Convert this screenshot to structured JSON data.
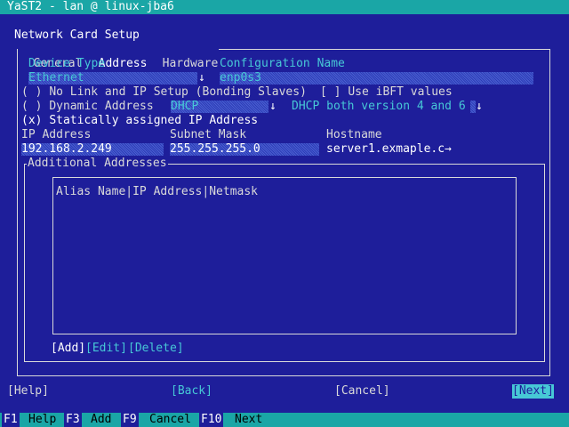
{
  "window": {
    "title": "YaST2 - lan @ linux-jba6"
  },
  "dialog": {
    "title": "Network Card Setup"
  },
  "tabs": [
    {
      "label": "General"
    },
    {
      "label": "Address",
      "selected": true
    },
    {
      "label": "Hardware"
    }
  ],
  "fields": {
    "device_type": {
      "label": "Device Type",
      "value": "Ethernet",
      "control": "dropdown"
    },
    "config_name": {
      "label": "Configuration Name",
      "value": "enp0s3"
    },
    "hostname": {
      "label": "Hostname",
      "value": "server1.exmaple.c→"
    },
    "ip_address": {
      "label": "IP Address",
      "value": "192.168.2.249"
    },
    "subnet_mask": {
      "label": "Subnet Mask",
      "value": "255.255.255.0"
    }
  },
  "options": {
    "no_link": {
      "mark": "( )",
      "label": "No Link and IP Setup (Bonding Slaves)"
    },
    "use_ibft": {
      "mark": "[ ]",
      "label": "Use iBFT values"
    },
    "dynamic": {
      "mark": "( )",
      "label": "Dynamic Address",
      "mode_value": "DHCP",
      "version_value": "DHCP both version 4 and 6"
    },
    "static": {
      "mark": "(x)",
      "label": "Statically assigned IP Address"
    }
  },
  "additional_addresses": {
    "title": "Additional Addresses",
    "columns": [
      "Alias Name",
      "IP Address",
      "Netmask"
    ],
    "rows": [],
    "buttons": {
      "add": "[Add]",
      "edit": "[Edit]",
      "delete": "[Delete]"
    }
  },
  "nav_buttons": {
    "help": "[Help]",
    "back": "[Back]",
    "cancel": "[Cancel]",
    "next": "[Next]"
  },
  "function_keys": [
    {
      "key": "F1",
      "label": "Help"
    },
    {
      "key": "F3",
      "label": "Add"
    },
    {
      "key": "F9",
      "label": "Cancel"
    },
    {
      "key": "F10",
      "label": "Next"
    }
  ],
  "colors": {
    "background": "#1e1e9a",
    "titlebar": "#1aa6a6",
    "label_cyan": "#47c8d6",
    "focus_highlight": "#47c8d6",
    "text": "#d9d9d9"
  }
}
